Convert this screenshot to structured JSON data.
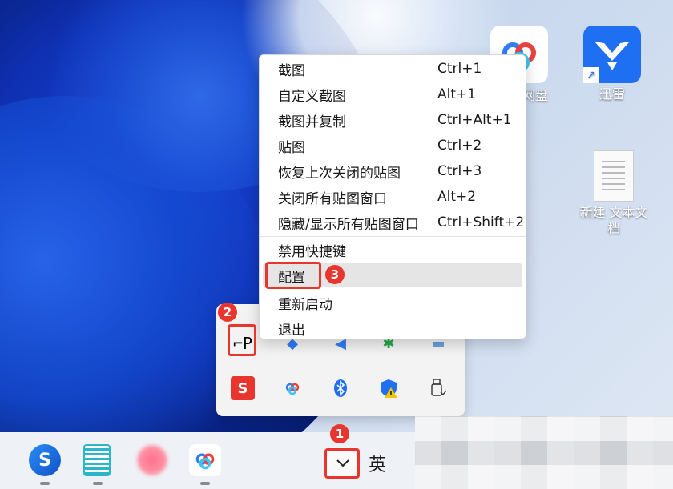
{
  "desktop": {
    "icons": [
      {
        "name": "百度网盘",
        "label": "网盘"
      },
      {
        "name": "迅雷",
        "label": "迅雷"
      },
      {
        "name": "新建 文本文档",
        "label_line1": "新建 文本文",
        "label_line2": "档"
      }
    ]
  },
  "context_menu": {
    "items": [
      {
        "label": "截图",
        "shortcut": "Ctrl+1"
      },
      {
        "label": "自定义截图",
        "shortcut": "Alt+1"
      },
      {
        "label": "截图并复制",
        "shortcut": "Ctrl+Alt+1"
      },
      {
        "label": "贴图",
        "shortcut": "Ctrl+2"
      },
      {
        "label": "恢复上次关闭的贴图",
        "shortcut": "Ctrl+3"
      },
      {
        "label": "关闭所有贴图窗口",
        "shortcut": "Alt+2"
      },
      {
        "label": "隐藏/显示所有贴图窗口",
        "shortcut": "Ctrl+Shift+2"
      },
      {
        "label": "禁用快捷键",
        "shortcut": ""
      },
      {
        "label": "配置",
        "shortcut": ""
      },
      {
        "label": "重新启动",
        "shortcut": ""
      },
      {
        "label": "退出",
        "shortcut": ""
      }
    ]
  },
  "annotations": {
    "step1": "1",
    "step2": "2",
    "step3": "3"
  },
  "taskbar": {
    "ime_label": "英"
  },
  "colors": {
    "annotation_red": "#e8352e",
    "xunlei_blue": "#1f6ff2"
  }
}
